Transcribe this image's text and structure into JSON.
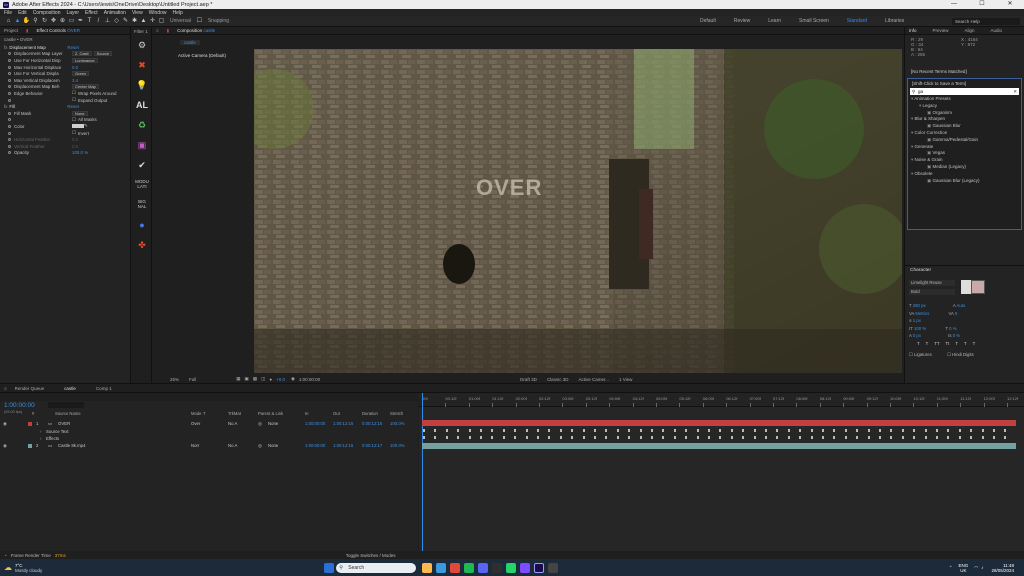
{
  "titlebar": {
    "title": "Adobe After Effects 2024 - C:\\Users\\lewis\\OneDrive\\Desktop\\Untitled Project.aep *",
    "app_icon": "Ae",
    "minimize": "—",
    "maximize": "☐",
    "close": "✕"
  },
  "menu": [
    "File",
    "Edit",
    "Composition",
    "Layer",
    "Effect",
    "Animation",
    "View",
    "Window",
    "Help"
  ],
  "toolbar": {
    "universal": "Universal",
    "snapping": "Snapping"
  },
  "workspaces": [
    {
      "label": "Default",
      "selected": false
    },
    {
      "label": "Review",
      "selected": false
    },
    {
      "label": "Learn",
      "selected": false
    },
    {
      "label": "Small Screen",
      "selected": false
    },
    {
      "label": "Standard",
      "selected": true
    },
    {
      "label": "Libraries",
      "selected": false
    }
  ],
  "search_help": {
    "placeholder": "Search Help"
  },
  "project_panel": {
    "tab_project": "Project",
    "tab_effect_controls": "Effect Controls",
    "effect_controls_layer": "OVER",
    "subtitle": "castle • OVER"
  },
  "effect_controls": [
    {
      "type": "effect",
      "label": "Displacement Map",
      "value": "Reset"
    },
    {
      "label": "Displacement Map Layer",
      "dd1": "2. Castl",
      "dd2": "Source"
    },
    {
      "label": "Use For Horizontal Disp",
      "dd1": "Luminance"
    },
    {
      "label": "Max Horizontal Displace",
      "value": "0.0"
    },
    {
      "label": "Use For Vertical Displa",
      "dd1": "Green"
    },
    {
      "label": "Max Vertical Displacem",
      "value": "3.4"
    },
    {
      "label": "Displacement Map Beh",
      "dd1": "Center Map"
    },
    {
      "label": "Edge Behavior",
      "check": "Wrap Pixels Around"
    },
    {
      "label": "",
      "check": "Expand Output"
    },
    {
      "type": "effect",
      "label": "Fill",
      "value": "Reset"
    },
    {
      "label": "Fill Mask",
      "dd1": "None"
    },
    {
      "label": "",
      "check": "All Masks"
    },
    {
      "label": "Color",
      "swatch": "#d0d0d0"
    },
    {
      "label": "",
      "check": "Invert"
    },
    {
      "label": "Horizontal Feather",
      "value": "0.0",
      "dim": true
    },
    {
      "label": "Vertical Feather",
      "value": "0.0",
      "dim": true
    },
    {
      "label": "Opacity",
      "value": "100.0 %"
    }
  ],
  "filter_strip": {
    "title": "Filter 1",
    "icons": [
      "gear-icon",
      "grid-icon",
      "bulb-icon",
      "al-icon",
      "recycle-icon",
      "monitor-icon",
      "check-icon",
      "modulati-icon",
      "big-nal-icon",
      "circle-icon",
      "target-icon"
    ],
    "al_text": "AL",
    "modulati_text": "MODU LATI",
    "signal_text": "BIG NAL"
  },
  "composition": {
    "tab": "Composition",
    "tab_name": "castle",
    "breadcrumb": "castle",
    "camera": "Active Camera (Default)",
    "overlay_text": "OVER",
    "zoom": "25%",
    "quality": "Full",
    "time": "1:00:00:00",
    "draft3d": "Draft 3D",
    "renderer": "Classic 3D",
    "camera_dd": "Active Camer...",
    "views": "1 View",
    "exposure": "+0.0"
  },
  "info_panel": {
    "tabs": [
      "Info",
      "Preview",
      "Align",
      "Audio"
    ],
    "r": "R : 29",
    "g": "G : 34",
    "b": "B : 64",
    "a": "A : 255",
    "x": "X : 4184",
    "y": "Y : 872",
    "recent": "[No Recent Terms Matched]",
    "save_hint": "[Shift-Click to Save a Term]",
    "search": "ga",
    "tree": [
      {
        "t": "Animation Presets",
        "lvl": 0
      },
      {
        "t": "Legacy",
        "lvl": 1
      },
      {
        "t": "Organism",
        "lvl": 2
      },
      {
        "t": "Blur & Sharpen",
        "lvl": 0
      },
      {
        "t": "Gaussian Blur",
        "lvl": 2
      },
      {
        "t": "Color Correction",
        "lvl": 0
      },
      {
        "t": "Gamma/Pedestal/Gain",
        "lvl": 2
      },
      {
        "t": "Generate",
        "lvl": 0
      },
      {
        "t": "Vegas",
        "lvl": 2
      },
      {
        "t": "Noise & Grain",
        "lvl": 0
      },
      {
        "t": "Median (Legacy)",
        "lvl": 2
      },
      {
        "t": "Obsolete",
        "lvl": 0
      },
      {
        "t": "Gaussian Blur (Legacy)",
        "lvl": 2
      }
    ]
  },
  "character": {
    "title": "Character",
    "font": "Limelight Reuse",
    "style": "Bold",
    "size": "280 px",
    "leading": "Auto",
    "tracking": "0",
    "kerning": "Metrics",
    "stroke": "1 px",
    "vscale": "100 %",
    "hscale": "0 %",
    "baseline": "0 px",
    "tsume": "0 %",
    "ligatures": "Ligatures",
    "hindi": "Hindi Digits",
    "styles": [
      "T",
      "T",
      "TT",
      "Tt",
      "T",
      "T",
      "T"
    ]
  },
  "timeline": {
    "tabs": [
      "Render Queue",
      "castle",
      "Comp 1"
    ],
    "timecode": "1:00:00:00",
    "fps_hint": "(25.00 fps)",
    "search_placeholder": "",
    "columns": [
      "#",
      "Source Name",
      "Mode",
      "T",
      "TrkMat",
      "Parent & Link",
      "In",
      "Out",
      "Duration",
      "Stretch"
    ],
    "layers": [
      {
        "num": "1",
        "name": "OVER",
        "mode": "Over",
        "trk": "No A",
        "parent": "None",
        "in": "1:00:00:00",
        "out": "1:00:12:16",
        "dur": "0:00:12:16",
        "stretch": "100.0%",
        "color": "#c24040"
      },
      {
        "num": "",
        "name": "Source Text",
        "sub": true
      },
      {
        "num": "",
        "name": "Effects",
        "sub": true
      },
      {
        "num": "2",
        "name": "Castle 8k.mp4",
        "mode": "Norr",
        "trk": "No A",
        "parent": "None",
        "in": "1:00:00:00",
        "out": "1:00:12:16",
        "dur": "0:00:12:17",
        "stretch": "100.0%",
        "color": "#73a0a0"
      }
    ],
    "ruler_labels": [
      "00f",
      "00:12f",
      "01:00f",
      "01:12f",
      "02:00f",
      "02:12f",
      "03:00f",
      "03:12f",
      "04:00f",
      "04:12f",
      "05:00f",
      "05:12f",
      "06:00f",
      "06:12f",
      "07:00f",
      "07:12f",
      "08:00f",
      "08:12f",
      "09:00f",
      "09:12f",
      "10:00f",
      "10:12f",
      "11:00f",
      "11:12f",
      "12:00f",
      "12:12f"
    ],
    "frame_render": "Frame Render Time",
    "frame_render_val": "37ms",
    "toggle": "Toggle Switches / Modes"
  },
  "taskbar": {
    "temp": "7°C",
    "weather": "Mostly cloudy",
    "search": "Search",
    "lang": "ENG",
    "region": "UK",
    "time": "11:48",
    "date": "28/05/2024"
  },
  "colors": {
    "accent": "#2d8ceb",
    "layer1": "#c24040",
    "layer2": "#73a0a0"
  }
}
